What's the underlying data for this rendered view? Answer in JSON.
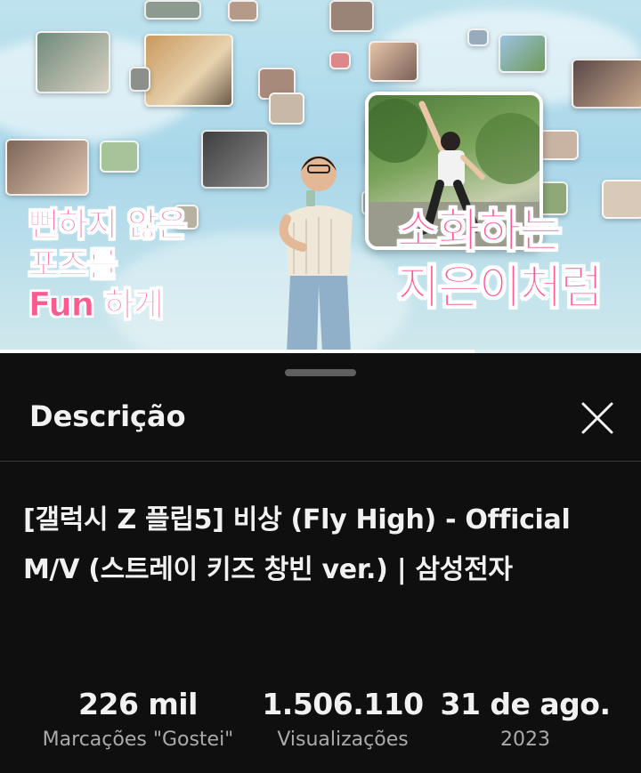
{
  "video": {
    "caption_left": [
      "뻔하지 않은",
      "포즈를",
      "Fun 하게"
    ],
    "caption_right": [
      "소화하는",
      "지은이처럼"
    ],
    "progress_fraction": 0.74
  },
  "sheet": {
    "title": "Descrição",
    "video_title": "[갤럭시 Z 플립5] 비상 (Fly High) - Official M/V (스트레이 키즈 창빈 ver.) | 삼성전자",
    "stats": {
      "likes": {
        "value": "226 mil",
        "label": "Marcações \"Gostei\""
      },
      "views": {
        "value": "1.506.110",
        "label": "Visualizações"
      },
      "date": {
        "value": "31 de ago.",
        "label": "2023"
      }
    }
  },
  "icons": {
    "close": "close-icon",
    "handle": "drag-handle"
  },
  "colors": {
    "background": "#0f0f0f",
    "text": "#f1f1f1",
    "secondary_text": "#aaaaaa",
    "caption_pink": "#ff5a8f"
  }
}
